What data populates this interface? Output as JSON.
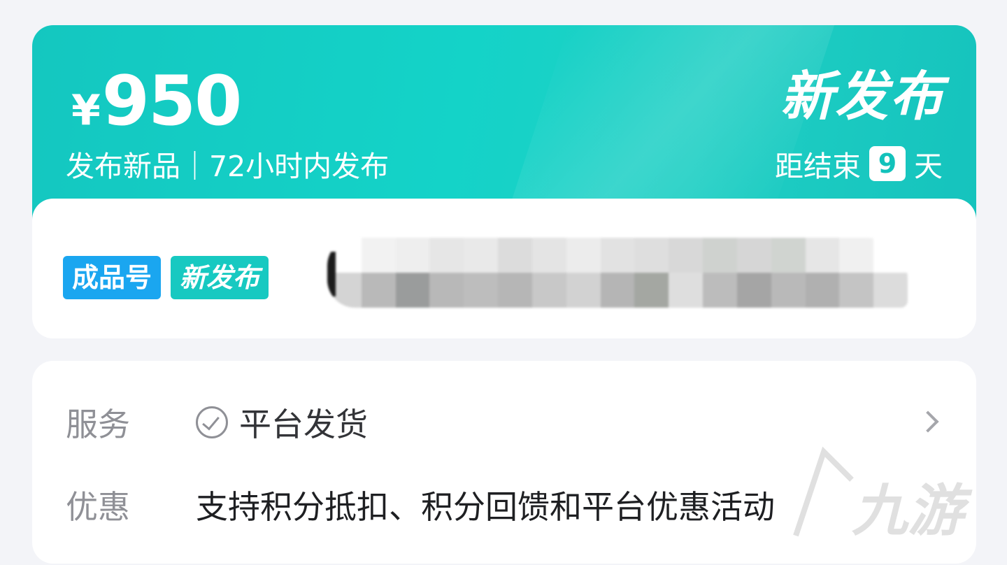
{
  "product": {
    "currency": "¥",
    "price": "950",
    "subtitle": "发布新品｜72小时内发布",
    "tag": "新发布",
    "countdown_prefix": "距结束",
    "countdown_days": "9",
    "countdown_suffix": "天",
    "badges": [
      {
        "label": "成品号",
        "color": "#1aa6f0"
      },
      {
        "label": "新发布",
        "color": "#17c9c1"
      }
    ]
  },
  "service": {
    "label": "服务",
    "value": "平台发货"
  },
  "discount": {
    "label": "优惠",
    "value": "支持积分抵扣、积分回馈和平台优惠活动"
  },
  "watermark": {
    "text": "九游"
  },
  "colors": {
    "accent": "#14c7c0",
    "badge_blue": "#1aa6f0",
    "background": "#f3f4f8"
  }
}
